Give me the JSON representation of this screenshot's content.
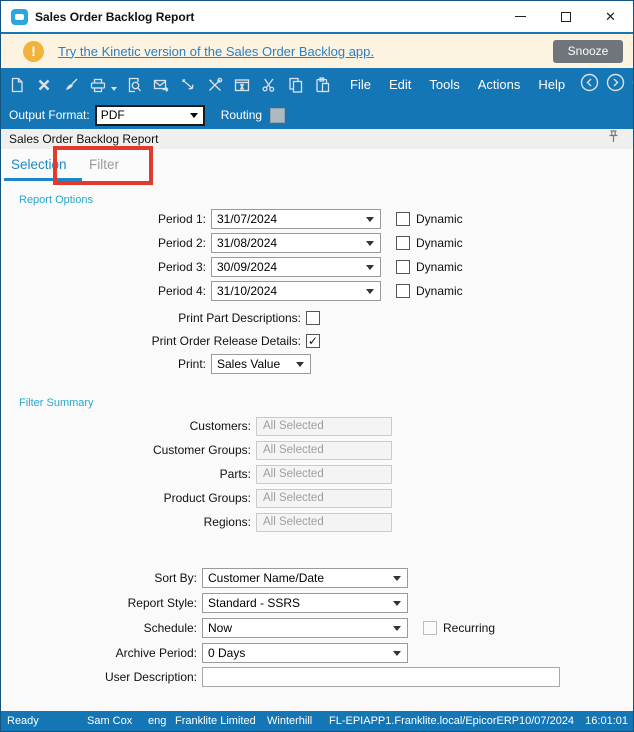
{
  "window": {
    "title": "Sales Order Backlog Report",
    "controls": {
      "minimize": "minimize",
      "maximize": "maximize",
      "close": "close"
    }
  },
  "banner": {
    "link_text": "Try the Kinetic version of the Sales Order Backlog app.",
    "snooze_label": "Snooze",
    "warning_icon": "exclamation-circle",
    "background_color": "#fcf3e1",
    "icon_color": "#f2b33d"
  },
  "toolbar": {
    "background_color": "#1576b5",
    "icons": [
      "new-document",
      "delete",
      "clear",
      "print",
      "print-preview",
      "send-email",
      "process",
      "report-tools",
      "schedule",
      "cut",
      "copy",
      "paste"
    ],
    "menu_items": [
      "File",
      "Edit",
      "Tools",
      "Actions",
      "Help"
    ],
    "nav_icons": [
      "back",
      "forward",
      "home"
    ]
  },
  "format_bar": {
    "label": "Output Format:",
    "value": "PDF",
    "routing_label": "Routing"
  },
  "panel": {
    "title": "Sales Order Backlog Report",
    "pin_icon": "push-pin"
  },
  "tabs": {
    "selection": "Selection",
    "filter": "Filter",
    "active": "Selection",
    "active_color": "#1e87c5",
    "annotation_color": "#e23a2c"
  },
  "report_options": {
    "section_label": "Report Options",
    "periods": [
      {
        "label": "Period 1:",
        "value": "31/07/2024",
        "dynamic_label": "Dynamic",
        "dynamic_checked": false
      },
      {
        "label": "Period 2:",
        "value": "31/08/2024",
        "dynamic_label": "Dynamic",
        "dynamic_checked": false
      },
      {
        "label": "Period 3:",
        "value": "30/09/2024",
        "dynamic_label": "Dynamic",
        "dynamic_checked": false
      },
      {
        "label": "Period 4:",
        "value": "31/10/2024",
        "dynamic_label": "Dynamic",
        "dynamic_checked": false
      }
    ],
    "print_part_descriptions_label": "Print Part Descriptions:",
    "print_part_descriptions_checked": false,
    "print_order_release_label": "Print Order Release Details:",
    "print_order_release_checked": true,
    "checkmark": "✓",
    "print_label": "Print:",
    "print_value": "Sales Value"
  },
  "filter_summary": {
    "section_label": "Filter Summary",
    "fields": [
      {
        "label": "Customers:",
        "value": "All Selected"
      },
      {
        "label": "Customer Groups:",
        "value": "All Selected"
      },
      {
        "label": "Parts:",
        "value": "All Selected"
      },
      {
        "label": "Product Groups:",
        "value": "All Selected"
      },
      {
        "label": "Regions:",
        "value": "All Selected"
      }
    ]
  },
  "options": {
    "sort_by_label": "Sort By:",
    "sort_by_value": "Customer Name/Date",
    "report_style_label": "Report Style:",
    "report_style_value": "Standard - SSRS",
    "schedule_label": "Schedule:",
    "schedule_value": "Now",
    "recurring_label": "Recurring",
    "recurring_checked": false,
    "archive_label": "Archive Period:",
    "archive_value": "0 Days",
    "user_description_label": "User Description:",
    "user_description_value": ""
  },
  "status_bar": {
    "state": "Ready",
    "user": "Sam Cox",
    "language": "eng",
    "company": "Franklite Limited",
    "site": "Winterhill",
    "server": "FL-EPIAPP1.Franklite.local/EpicorERP",
    "date": "10/07/2024",
    "time": "16:01:01",
    "background_color": "#1576b5"
  }
}
